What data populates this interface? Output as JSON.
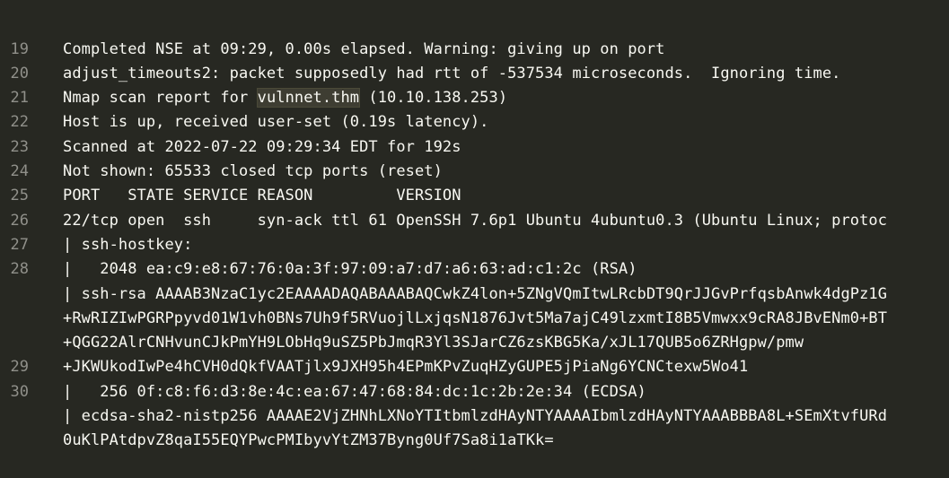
{
  "editor": {
    "rows": [
      {
        "ln": "",
        "text": "Completed NSE at 09:29, 0.00s elapsed. Warning: giving up on port"
      },
      {
        "ln": "19",
        "text": "adjust_timeouts2: packet supposedly had rtt of -537534 microseconds.  Ignoring time."
      },
      {
        "ln": "20",
        "pre": "Nmap scan report for ",
        "highlight": "vulnnet.thm",
        "post": " (10.10.138.253)"
      },
      {
        "ln": "21",
        "text": "Host is up, received user-set (0.19s latency)."
      },
      {
        "ln": "22",
        "text": "Scanned at 2022-07-22 09:29:34 EDT for 192s"
      },
      {
        "ln": "23",
        "text": "Not shown: 65533 closed tcp ports (reset)"
      },
      {
        "ln": "24",
        "text": "PORT   STATE SERVICE REASON         VERSION"
      },
      {
        "ln": "25",
        "text": "22/tcp open  ssh     syn-ack ttl 61 OpenSSH 7.6p1 Ubuntu 4ubuntu0.3 (Ubuntu Linux; protoc"
      },
      {
        "ln": "26",
        "text": "| ssh-hostkey:"
      },
      {
        "ln": "27",
        "text": "|   2048 ea:c9:e8:67:76:0a:3f:97:09:a7:d7:a6:63:ad:c1:2c (RSA)"
      },
      {
        "ln": "28",
        "text": "| ssh-rsa AAAAB3NzaC1yc2EAAAADAQABAAABAQCwkZ4lon+5ZNgVQmItwLRcbDT9QrJJGvPrfqsbAnwk4dgPz1G"
      },
      {
        "ln": "",
        "text": "+RwRIZIwPGRPpyvd01W1vh0BNs7Uh9f5RVuojlLxjqsN1876Jvt5Ma7ajC49lzxmtI8B5Vmwxx9cRA8JBvENm0+BT"
      },
      {
        "ln": "",
        "text": "+QGG22AlrCNHvunCJkPmYH9LObHq9uSZ5PbJmqR3Yl3SJarCZ6zsKBG5Ka/xJL17QUB5o6ZRHgpw/pmw"
      },
      {
        "ln": "",
        "text": "+JKWUkodIwPe4hCVH0dQkfVAATjlx9JXH95h4EPmKPvZuqHZyGUPE5jPiaNg6YCNCtexw5Wo41"
      },
      {
        "ln": "29",
        "text": "|   256 0f:c8:f6:d3:8e:4c:ea:67:47:68:84:dc:1c:2b:2e:34 (ECDSA)"
      },
      {
        "ln": "30",
        "text": "| ecdsa-sha2-nistp256 AAAAE2VjZHNhLXNoYTItbmlzdHAyNTYAAAAIbmlzdHAyNTYAAABBBA8L+SEmXtvfURd"
      },
      {
        "ln": "",
        "text": "0uKlPAtdpvZ8qaI55EQYPwcPMIbyvYtZM37Byng0Uf7Sa8i1aTKk="
      }
    ]
  }
}
